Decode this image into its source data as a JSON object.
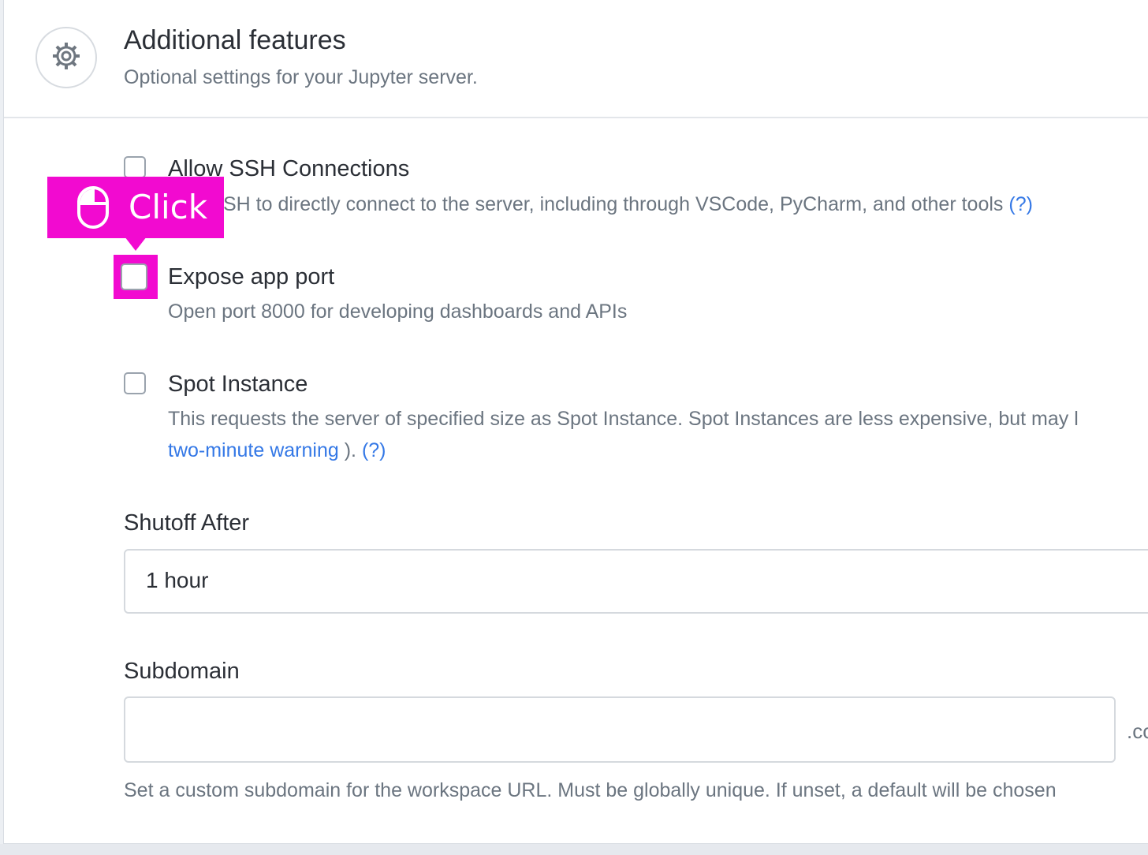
{
  "header": {
    "title": "Additional features",
    "subtitle": "Optional settings for your Jupyter server.",
    "icon": "gear-icon"
  },
  "options": {
    "ssh": {
      "title": "Allow SSH Connections",
      "desc_visible": "SH to directly connect to the server, including through VSCode, PyCharm, and other tools",
      "help_link": "(?)",
      "checked": false
    },
    "app_port": {
      "title": "Expose app port",
      "desc": "Open port 8000 for developing dashboards and APIs",
      "checked": false
    },
    "spot": {
      "title": "Spot Instance",
      "desc": "This requests the server of specified size as Spot Instance. Spot Instances are less expensive, but may l",
      "link_warning": "two-minute warning",
      "after_link": " ).",
      "help_link": "(?)",
      "checked": false
    }
  },
  "shutoff": {
    "label": "Shutoff After",
    "value": "1 hour"
  },
  "subdomain": {
    "label": "Subdomain",
    "value": "",
    "suffix": ".co",
    "help": "Set a custom subdomain for the workspace URL. Must be globally unique. If unset, a default will be chosen"
  },
  "annotation": {
    "label": "Click",
    "color": "#f20ad0"
  }
}
